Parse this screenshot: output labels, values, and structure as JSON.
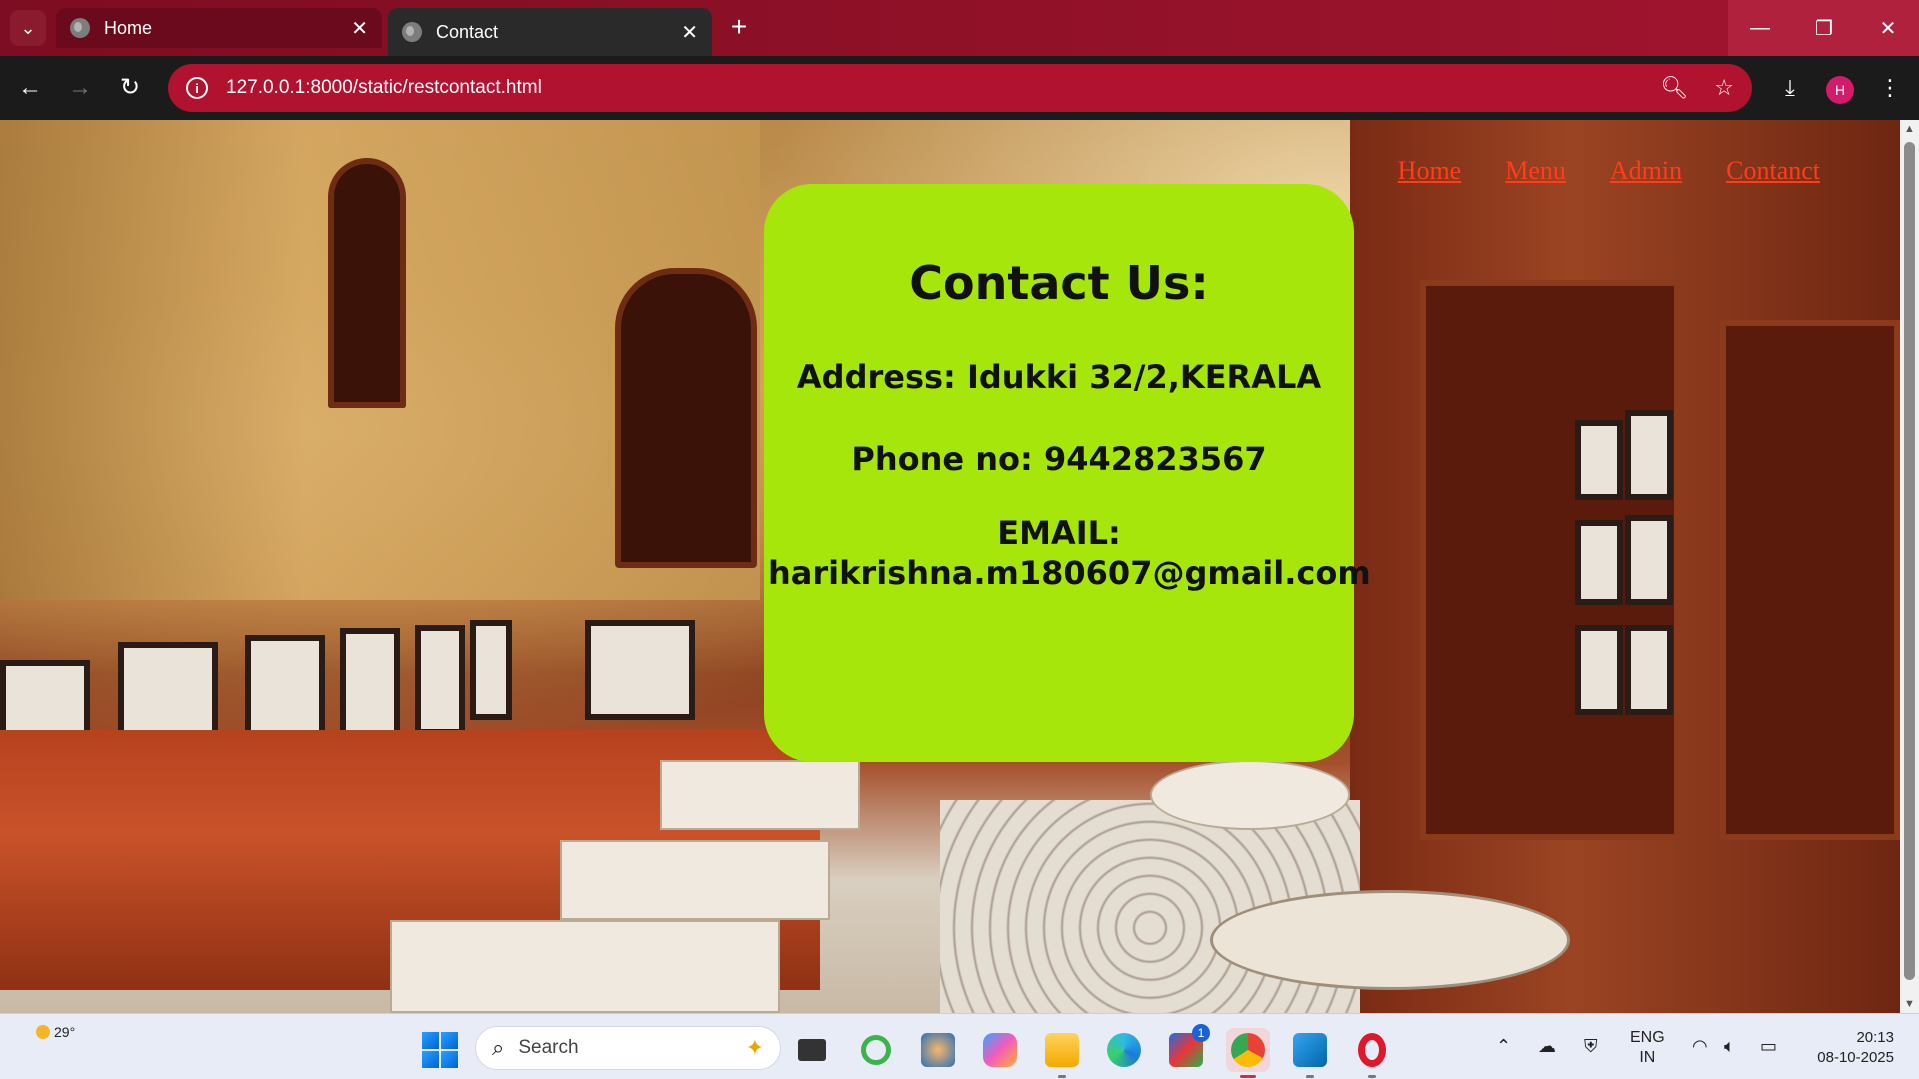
{
  "browser": {
    "tabs": [
      {
        "title": "Home",
        "active": false
      },
      {
        "title": "Contact",
        "active": true
      }
    ],
    "url": "127.0.0.1:8000/static/restcontact.html",
    "accent_color": "#b0122f",
    "profile_initial": "H"
  },
  "page": {
    "nav": [
      "Home",
      "Menu",
      "Admin",
      "Contanct"
    ],
    "nav_color": "#ff3d1c",
    "card": {
      "heading": "Contact Us:",
      "address": "Address: Idukki 32/2,KERALA",
      "phone": "Phone no: 9442823567",
      "email_label": "EMAIL:",
      "email": "harikrishna.m180607@gmail.com",
      "background": "#a6e60a"
    }
  },
  "taskbar": {
    "weather_temp": "29°",
    "search_placeholder": "Search",
    "store_badge": "1",
    "lang_primary": "ENG",
    "lang_secondary": "IN",
    "time": "20:13",
    "date": "08-10-2025"
  }
}
